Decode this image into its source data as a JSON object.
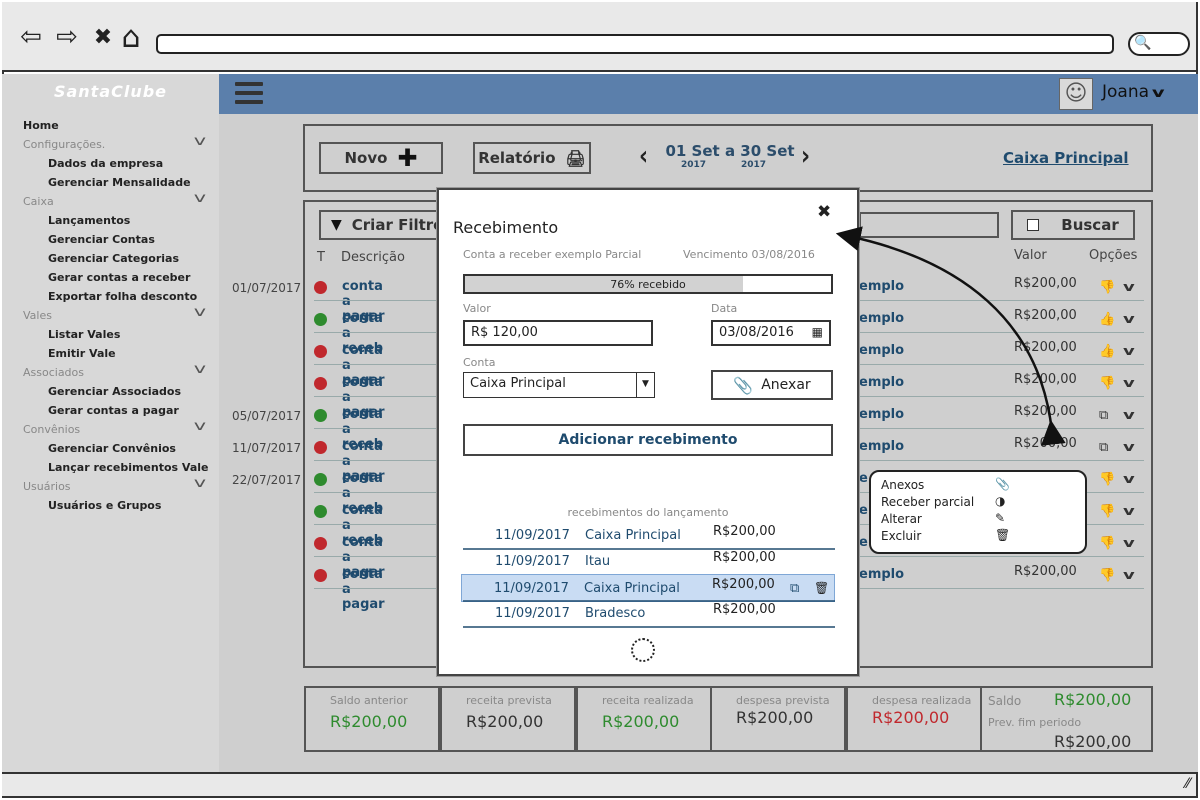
{
  "browser": {
    "back_icon": "⇦",
    "forward_icon": "⇨",
    "close_icon": "✖",
    "home_icon": "⌂",
    "search_icon": "🔍"
  },
  "sidebar": {
    "brand": "SantaClube",
    "home": "Home",
    "sections": [
      {
        "label": "Configurações.",
        "items": [
          "Dados da empresa",
          "Gerenciar Mensalidade"
        ]
      },
      {
        "label": "Caixa",
        "items": [
          "Lançamentos",
          "Gerenciar Contas",
          "Gerenciar Categorias",
          "Gerar contas a receber",
          "Exportar folha desconto"
        ]
      },
      {
        "label": "Vales",
        "items": [
          "Listar Vales",
          "Emitir Vale"
        ]
      },
      {
        "label": "Associados",
        "items": [
          "Gerenciar Associados",
          "Gerar contas a pagar"
        ]
      },
      {
        "label": "Convênios",
        "items": [
          "Gerenciar Convênios",
          "Lançar recebimentos Vale"
        ]
      },
      {
        "label": "Usuários",
        "items": [
          "Usuários e Grupos"
        ]
      }
    ]
  },
  "header": {
    "user": "Joana"
  },
  "toolbar": {
    "novo": "Novo",
    "relatorio": "Relatório",
    "period_start": "01 Set",
    "period_sep": "a",
    "period_end": "30 Set",
    "year_start": "2017",
    "year_end": "2017",
    "caixa_link": "Caixa Principal"
  },
  "filter": {
    "criar_filtro": "Criar Filtro",
    "buscar": "Buscar"
  },
  "table": {
    "col_t": "T",
    "col_desc": "Descrição",
    "col_valor": "Valor",
    "col_opcoes": "Opções",
    "rows": [
      {
        "date": "01/07/2017",
        "status": "red",
        "desc": "conta a pagar",
        "tail": "emplo",
        "valor": "R$200,00",
        "opt": "dislike"
      },
      {
        "date": "",
        "status": "green",
        "desc": "conta a receb",
        "tail": "emplo",
        "valor": "R$200,00",
        "opt": "like-green"
      },
      {
        "date": "",
        "status": "red",
        "desc": "conta a pagar",
        "tail": "emplo",
        "valor": "R$200,00",
        "opt": "like-red"
      },
      {
        "date": "",
        "status": "red",
        "desc": "conta a pagar",
        "tail": "emplo",
        "valor": "R$200,00",
        "opt": "dislike"
      },
      {
        "date": "05/07/2017",
        "status": "green",
        "desc": "conta a receb",
        "tail": "emplo",
        "valor": "R$200,00",
        "opt": "copy"
      },
      {
        "date": "11/07/2017",
        "status": "red",
        "desc": "conta a pagar",
        "tail": "emplo",
        "valor": "R$200,00",
        "opt": "copy"
      },
      {
        "date": "22/07/2017",
        "status": "green",
        "desc": "conta a receb",
        "tail": "e",
        "valor": "",
        "opt": "dislike"
      },
      {
        "date": "",
        "status": "green",
        "desc": "conta a receb",
        "tail": "e",
        "valor": "",
        "opt": "dislike"
      },
      {
        "date": "",
        "status": "red",
        "desc": "conta a pagar",
        "tail": "e",
        "valor": "",
        "opt": "dislike"
      },
      {
        "date": "",
        "status": "red",
        "desc": "conta a pagar",
        "tail": "emplo",
        "valor": "R$200,00",
        "opt": "dislike"
      }
    ]
  },
  "summary": [
    {
      "label": "Saldo anterior",
      "value": "R$200,00",
      "color": "#2e8b2e"
    },
    {
      "label": "receita prevista",
      "value": "R$200,00",
      "color": "#333333"
    },
    {
      "label": "receita realizada",
      "value": "R$200,00",
      "color": "#2e8b2e"
    },
    {
      "label": "despesa prevista",
      "value": "R$200,00",
      "color": "#333333"
    },
    {
      "label": "despesa realizada",
      "value": "R$200,00",
      "color": "#c0282d"
    }
  ],
  "saldo": {
    "label": "Saldo",
    "value": "R$200,00",
    "prev_label": "Prev. fim periodo",
    "prev_value": "R$200,00"
  },
  "modal": {
    "title": "Recebimento",
    "close": "✖",
    "conta_desc": "Conta a receber exemplo Parcial",
    "vencimento": "Vencimento 03/08/2016",
    "progress_text": "76% recebido",
    "progress_pct": 76,
    "valor_label": "Valor",
    "valor": "R$ 120,00",
    "data_label": "Data",
    "data": "03/08/2016",
    "conta_label": "Conta",
    "conta": "Caixa Principal",
    "anexar": "Anexar",
    "adicionar": "Adicionar recebimento",
    "list_title": "recebimentos do lançamento",
    "receipts": [
      {
        "date": "11/09/2017",
        "account": "Caixa Principal",
        "value": "R$200,00"
      },
      {
        "date": "11/09/2017",
        "account": "Itau",
        "value": "R$200,00"
      },
      {
        "date": "11/09/2017",
        "account": "Caixa Principal",
        "value": "R$200,00",
        "selected": true
      },
      {
        "date": "11/09/2017",
        "account": "Bradesco",
        "value": "R$200,00"
      }
    ]
  },
  "popover": {
    "items": [
      {
        "label": "Anexos",
        "icon": "📎"
      },
      {
        "label": "Receber parcial",
        "icon": "◑"
      },
      {
        "label": "Alterar",
        "icon": "✎"
      },
      {
        "label": "Excluir",
        "icon": "🗑"
      }
    ]
  },
  "colors": {
    "accent": "#5b7fab",
    "link": "#1f4b6e",
    "green": "#2e8b2e",
    "red": "#c0282d",
    "selected": "#c9dcf3"
  }
}
